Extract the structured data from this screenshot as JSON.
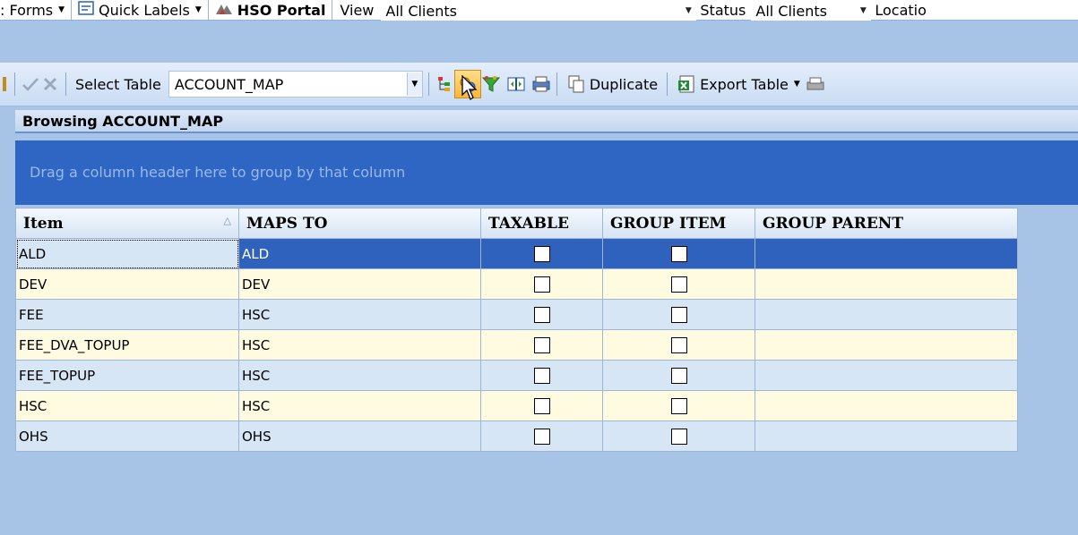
{
  "toolbar_top": {
    "forms_label": ": Forms",
    "quick_labels": "Quick Labels",
    "portal_label": "HSO Portal",
    "view_label": "View",
    "view_value": "All Clients",
    "status_label": "Status",
    "status_value": "All Clients",
    "location_label": "Locatio"
  },
  "toolbar_main": {
    "select_table_label": "Select Table",
    "select_table_value": "ACCOUNT_MAP",
    "duplicate_label": "Duplicate",
    "export_label": "Export Table"
  },
  "browse": {
    "title": "Browsing ACCOUNT_MAP",
    "group_hint": "Drag a column header here to group by that column"
  },
  "grid": {
    "columns": [
      "Item",
      "MAPS TO",
      "TAXABLE",
      "GROUP ITEM",
      "GROUP PARENT"
    ],
    "rows": [
      {
        "item": "ALD",
        "maps_to": "ALD"
      },
      {
        "item": "DEV",
        "maps_to": "DEV"
      },
      {
        "item": "FEE",
        "maps_to": "HSC"
      },
      {
        "item": "FEE_DVA_TOPUP",
        "maps_to": "HSC"
      },
      {
        "item": "FEE_TOPUP",
        "maps_to": "HSC"
      },
      {
        "item": "HSC",
        "maps_to": "HSC"
      },
      {
        "item": "OHS",
        "maps_to": "OHS"
      }
    ]
  },
  "colors": {
    "selection": "#2e62bd",
    "group_panel": "#2f66c4",
    "row_blue": "#d6e6f5",
    "row_yellow": "#fefbe0"
  }
}
